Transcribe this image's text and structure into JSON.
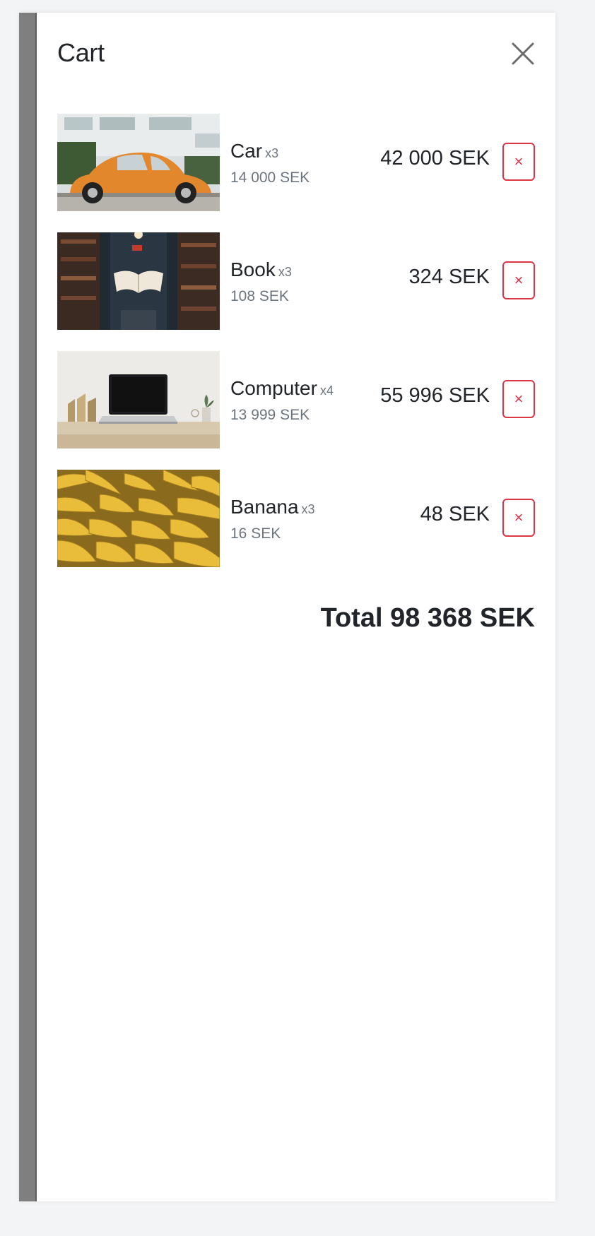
{
  "cart": {
    "title": "Cart",
    "close_icon": "close-icon",
    "items": [
      {
        "name": "Car",
        "qty": "x3",
        "unit_price": "14 000 SEK",
        "line_total": "42 000 SEK",
        "remove_label": "×",
        "image": "orange-beetle-car"
      },
      {
        "name": "Book",
        "qty": "x3",
        "unit_price": "108 SEK",
        "line_total": "324 SEK",
        "remove_label": "×",
        "image": "open-book-library"
      },
      {
        "name": "Computer",
        "qty": "x4",
        "unit_price": "13 999 SEK",
        "line_total": "55 996 SEK",
        "remove_label": "×",
        "image": "laptop-on-desk"
      },
      {
        "name": "Banana",
        "qty": "x3",
        "unit_price": "16 SEK",
        "line_total": "48 SEK",
        "remove_label": "×",
        "image": "banana-pile"
      }
    ],
    "total_label": "Total 98 368 SEK"
  },
  "colors": {
    "danger": "#dc3545",
    "muted": "#6c757d",
    "text": "#212529",
    "backdrop": "#7f7f7f"
  }
}
